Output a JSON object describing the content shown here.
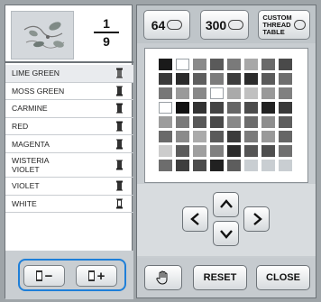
{
  "preview": {
    "page_current": "1",
    "page_total": "9"
  },
  "thread_list": [
    {
      "name": "LIME GREEN",
      "spool": "light"
    },
    {
      "name": "MOSS GREEN",
      "spool": "dark"
    },
    {
      "name": "CARMINE",
      "spool": "dark"
    },
    {
      "name": "RED",
      "spool": "dark"
    },
    {
      "name": "MAGENTA",
      "spool": "dark"
    },
    {
      "name_line1": "WISTERIA",
      "name_line2": "VIOLET",
      "spool": "dark"
    },
    {
      "name": "VIOLET",
      "spool": "dark"
    },
    {
      "name": "WHITE",
      "spool": "white"
    }
  ],
  "top_buttons": {
    "b64": "64",
    "b300": "300",
    "custom": [
      "CUSTOM",
      "THREAD",
      "TABLE"
    ]
  },
  "bottom_buttons": {
    "reset": "RESET",
    "close": "CLOSE"
  },
  "spool_buttons": {
    "remove": "−",
    "add": "+"
  }
}
